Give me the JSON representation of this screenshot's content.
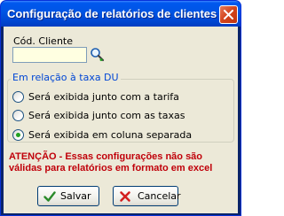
{
  "window": {
    "title": "Configuração de relatórios de clientes"
  },
  "form": {
    "cod_cliente_label": "Cód. Cliente",
    "cod_cliente_value": ""
  },
  "taxa_group": {
    "legend": "Em relação à taxa DU",
    "options": [
      {
        "label": "Será exibida junto com a tarifa",
        "selected": false
      },
      {
        "label": "Será exibida junto com as taxas",
        "selected": false
      },
      {
        "label": "Será exibida em coluna separada",
        "selected": true
      }
    ]
  },
  "warning": {
    "text": "ATENÇÃO - Essas configurações não são válidas para relatórios em formato em excel"
  },
  "buttons": {
    "save_label": "Salvar",
    "cancel_label": "Cancelar"
  },
  "colors": {
    "titlebar": "#0055e5",
    "client_bg": "#ece9d8",
    "group_legend": "#0046d5",
    "warning": "#c0000a",
    "radio_selected": "#21a121"
  },
  "icons": {
    "close": "close-icon",
    "search": "search-icon",
    "save": "checkmark-icon",
    "cancel": "x-mark-icon"
  }
}
